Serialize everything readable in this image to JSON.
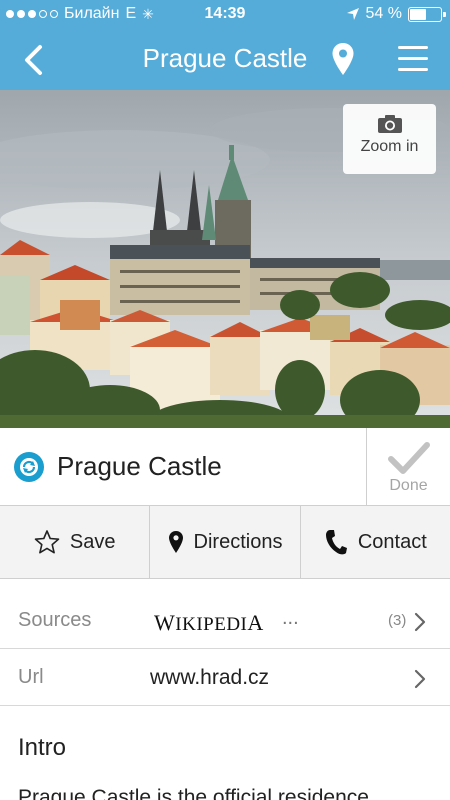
{
  "status_bar": {
    "carrier": "Билайн",
    "network": "E",
    "time": "14:39",
    "battery_percent": "54 %",
    "battery_level": 0.54
  },
  "nav": {
    "title": "Prague Castle",
    "back_icon": "chevron-left-icon",
    "location_icon": "map-pin-icon",
    "menu_icon": "hamburger-menu-icon"
  },
  "hero": {
    "zoom_label": "Zoom in",
    "zoom_icon": "camera-icon"
  },
  "place": {
    "title": "Prague Castle",
    "done_label": "Done",
    "accent": "#1a9dcf"
  },
  "actions": [
    {
      "label": "Save",
      "icon": "star-outline-icon"
    },
    {
      "label": "Directions",
      "icon": "map-pin-icon"
    },
    {
      "label": "Contact",
      "icon": "phone-icon"
    }
  ],
  "sources": {
    "label": "Sources",
    "logo_text": "Wikipedia",
    "more": "...",
    "count": "(3)"
  },
  "url": {
    "label": "Url",
    "value": "www.hrad.cz"
  },
  "intro": {
    "heading": "Intro",
    "text": "Prague Castle is the official residence"
  },
  "colors": {
    "brand": "#55acd9",
    "text": "#222222",
    "muted": "#8a8a8a"
  }
}
